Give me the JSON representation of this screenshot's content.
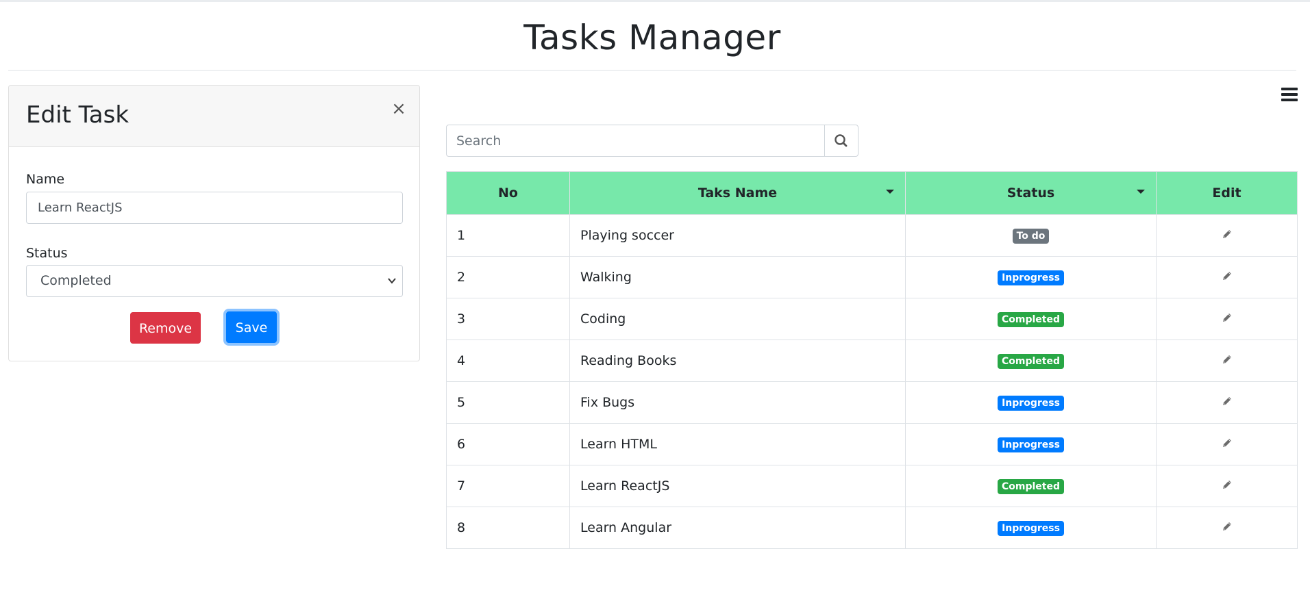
{
  "page": {
    "title": "Tasks Manager"
  },
  "edit_panel": {
    "title": "Edit Task",
    "close_glyph": "×",
    "name_label": "Name",
    "name_value": "Learn ReactJS",
    "status_label": "Status",
    "status_selected": "Completed",
    "remove_label": "Remove",
    "save_label": "Save"
  },
  "search": {
    "placeholder": "Search"
  },
  "table": {
    "headers": {
      "no": "No",
      "name": "Taks Name",
      "status": "Status",
      "edit": "Edit"
    },
    "rows": [
      {
        "no": "1",
        "name": "Playing soccer",
        "status": "To do"
      },
      {
        "no": "2",
        "name": "Walking",
        "status": "Inprogress"
      },
      {
        "no": "3",
        "name": "Coding",
        "status": "Completed"
      },
      {
        "no": "4",
        "name": "Reading Books",
        "status": "Completed"
      },
      {
        "no": "5",
        "name": "Fix Bugs",
        "status": "Inprogress"
      },
      {
        "no": "6",
        "name": "Learn HTML",
        "status": "Inprogress"
      },
      {
        "no": "7",
        "name": "Learn ReactJS",
        "status": "Completed"
      },
      {
        "no": "8",
        "name": "Learn Angular",
        "status": "Inprogress"
      }
    ]
  },
  "colors": {
    "header_bg": "#77e8aa",
    "todo": "#6c757d",
    "inprogress": "#007bff",
    "completed": "#28a745",
    "remove": "#dc3545",
    "save": "#007bff"
  },
  "icons": {
    "menu": "hamburger-icon",
    "search": "search-icon",
    "edit": "pencil-icon",
    "sort": "caret-down-icon"
  }
}
